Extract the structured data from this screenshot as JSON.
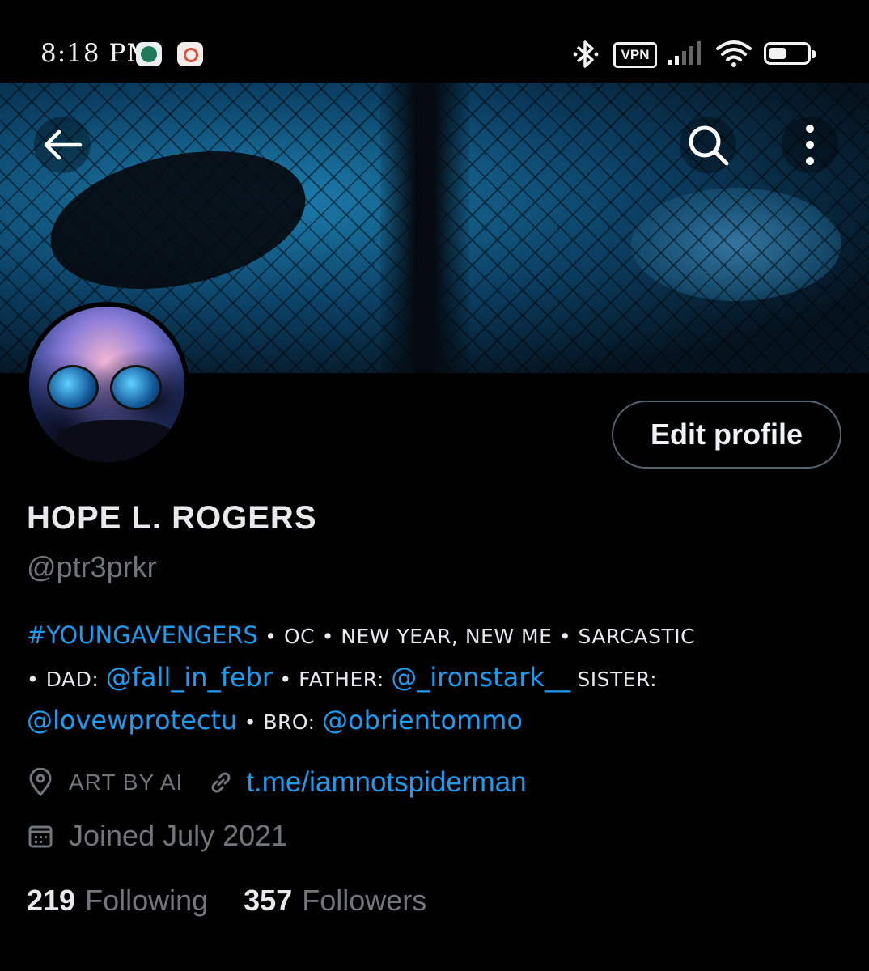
{
  "status_bar": {
    "time": "8:18 PM",
    "vpn_label": "VPN",
    "battery_level": 0.45
  },
  "profile": {
    "display_name": "HOPE L. ROGERS",
    "handle": "@ptr3prkr",
    "edit_button_label": "Edit profile",
    "bio": {
      "hashtag": "#YOUNGAVENGERS",
      "part1": " • OC • NEW YEAR, NEW ME • SARCASTIC",
      "part2a": "• DAD: ",
      "mention_dad": "@fall_in_febr",
      "part2b": " • FATHER: ",
      "mention_father": "@_ironstark__",
      "part2c": " SISTER: ",
      "mention_sister": "@lovewprotectu",
      "part3a": " • BRO: ",
      "mention_bro": "@obrientommo"
    },
    "location": "ART BY AI",
    "website": "t.me/iamnotspiderman",
    "joined": "Joined July 2021",
    "following_count": "219",
    "following_label": "Following",
    "followers_count": "357",
    "followers_label": "Followers"
  },
  "icons": {
    "back": "arrow-left-icon",
    "search": "search-icon",
    "more": "more-vertical-icon",
    "location": "location-pin-icon",
    "link": "link-icon",
    "calendar": "calendar-icon"
  },
  "colors": {
    "background": "#000000",
    "accent": "#1d9bf0",
    "secondary_text": "#71767b",
    "primary_text": "#e7e9ea"
  }
}
